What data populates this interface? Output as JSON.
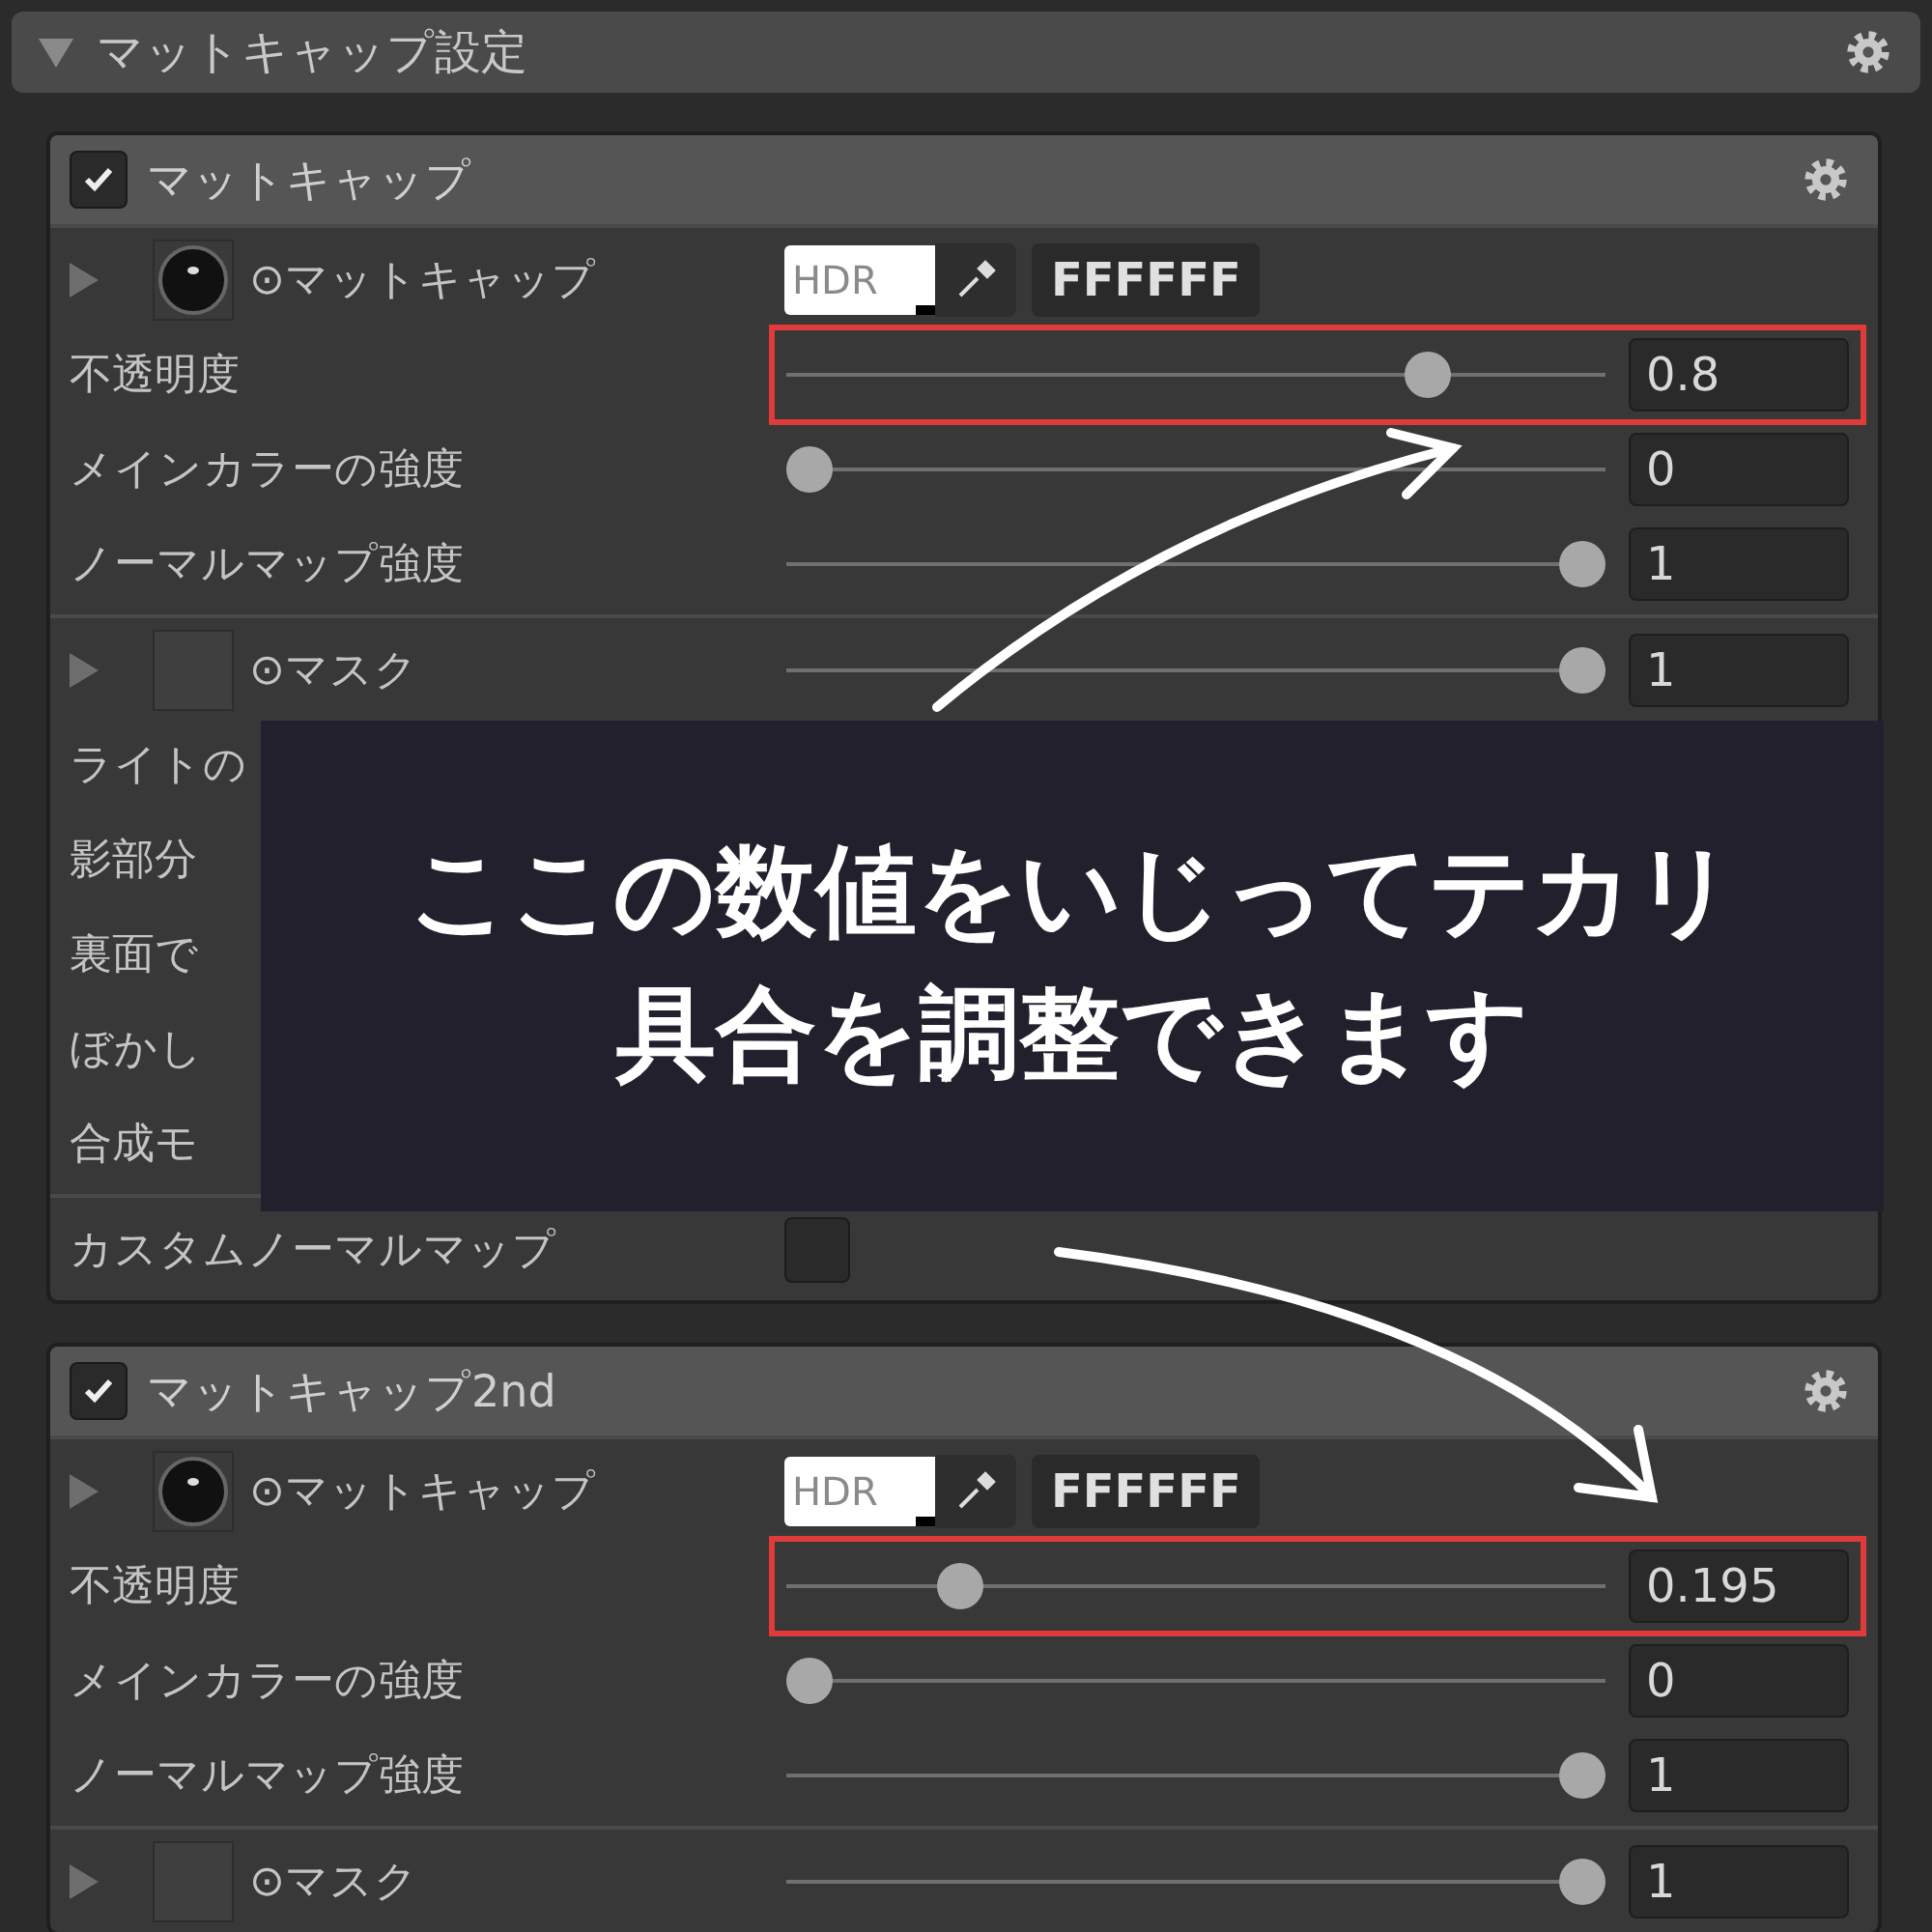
{
  "panel": {
    "title": "マットキャップ設定",
    "expanded": true
  },
  "sections": [
    {
      "title": "マットキャップ",
      "enabled": true,
      "groups": [
        [
          {
            "kind": "texture",
            "label": "⊙マットキャップ",
            "hdr": "HDR",
            "hex": "FFFFFF"
          },
          {
            "kind": "slider",
            "label": "不透明度",
            "level": 0.8,
            "reading": "0.8",
            "highlighted": true
          },
          {
            "kind": "slider",
            "label": "メインカラーの強度",
            "level": 0,
            "reading": "0",
            "highlighted": false
          },
          {
            "kind": "slider",
            "label": "ノーマルマップ強度",
            "level": 1,
            "reading": "1",
            "highlighted": false
          }
        ],
        [
          {
            "kind": "mask",
            "label": "⊙マスク",
            "level": 1,
            "reading": "1"
          },
          {
            "kind": "label",
            "label": "ライトの"
          },
          {
            "kind": "label",
            "label": "影部分"
          },
          {
            "kind": "label",
            "label": "裏面で"
          },
          {
            "kind": "label",
            "label": "ぼかし"
          },
          {
            "kind": "label",
            "label": "合成モ"
          }
        ],
        [
          {
            "kind": "checkbox",
            "label": "カスタムノーマルマップ",
            "checked": false
          }
        ]
      ]
    },
    {
      "title": "マットキャップ2nd",
      "enabled": true,
      "groups": [
        [
          {
            "kind": "texture",
            "label": "⊙マットキャップ",
            "hdr": "HDR",
            "hex": "FFFFFF"
          },
          {
            "kind": "slider",
            "label": "不透明度",
            "level": 0.195,
            "reading": "0.195",
            "highlighted": true
          },
          {
            "kind": "slider",
            "label": "メインカラーの強度",
            "level": 0,
            "reading": "0",
            "highlighted": false
          },
          {
            "kind": "slider",
            "label": "ノーマルマップ強度",
            "level": 1,
            "reading": "1",
            "highlighted": false
          }
        ],
        [
          {
            "kind": "mask",
            "label": "⊙マスク",
            "level": 1,
            "reading": "1"
          }
        ]
      ]
    }
  ],
  "overlay": {
    "lines": [
      "ここの数値をいじってテカリ",
      "具合を調整できます"
    ]
  }
}
